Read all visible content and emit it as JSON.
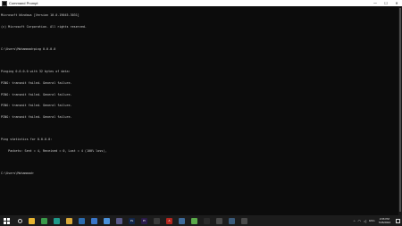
{
  "window": {
    "title": "Command Prompt",
    "minimize_glyph": "—",
    "maximize_glyph": "☐",
    "close_glyph": "✕"
  },
  "console": {
    "lines": [
      "Microsoft Windows [Version 10.0.19045.3031]",
      "(c) Microsoft Corporation. All rights reserved.",
      "",
      "C:\\Users\\Mohammad>ping 0.0.0.0",
      "",
      "Pinging 0.0.0.0 with 32 bytes of data:",
      "PING: transmit failed. General failure.",
      "PING: transmit failed. General failure.",
      "PING: transmit failed. General failure.",
      "PING: transmit failed. General failure.",
      "",
      "Ping statistics for 0.0.0.0:",
      "    Packets: Sent = 4, Received = 0, Lost = 4 (100% loss),",
      "",
      "C:\\Users\\Mohammad>"
    ]
  },
  "taskbar": {
    "apps": [
      {
        "icon": "file-explorer-icon",
        "color": "#e8b531",
        "glyph": ""
      },
      {
        "icon": "chrome-icon",
        "color": "#3a9b4a",
        "glyph": ""
      },
      {
        "icon": "edge-icon",
        "color": "#1f9a8a",
        "glyph": ""
      },
      {
        "icon": "folder-icon",
        "color": "#d9a93a",
        "glyph": ""
      },
      {
        "icon": "terminal-icon",
        "color": "#2b6cb0",
        "glyph": ""
      },
      {
        "icon": "store-icon",
        "color": "#3a76c9",
        "glyph": ""
      },
      {
        "icon": "photos-icon",
        "color": "#4a90d9",
        "glyph": ""
      },
      {
        "icon": "app-icon",
        "color": "#5a5a8a",
        "glyph": ""
      },
      {
        "icon": "photoshop-icon",
        "color": "#12264a",
        "glyph": "Ps"
      },
      {
        "icon": "premiere-icon",
        "color": "#2a1a4a",
        "glyph": "Pr"
      },
      {
        "icon": "app-icon",
        "color": "#3a3a3a",
        "glyph": ""
      },
      {
        "icon": "acrobat-icon",
        "color": "#b3261e",
        "glyph": "A"
      },
      {
        "icon": "app-icon",
        "color": "#3d6a9a",
        "glyph": ""
      },
      {
        "icon": "app-icon",
        "color": "#5aaa4a",
        "glyph": ""
      },
      {
        "icon": "app-icon",
        "color": "#2a2a2a",
        "glyph": ""
      },
      {
        "icon": "settings-icon",
        "color": "#4a4a4a",
        "glyph": ""
      },
      {
        "icon": "app-icon",
        "color": "#3a5a7a",
        "glyph": ""
      },
      {
        "icon": "app-icon",
        "color": "#4a4a4a",
        "glyph": ""
      }
    ]
  },
  "tray": {
    "chevron": "^",
    "language": "ENG",
    "time": "2:06 PM",
    "date": "7/26/2024"
  },
  "colors": {
    "console_bg": "#0c0c0c",
    "console_text": "#cccccc",
    "taskbar_bg": "#1c1c1c"
  }
}
